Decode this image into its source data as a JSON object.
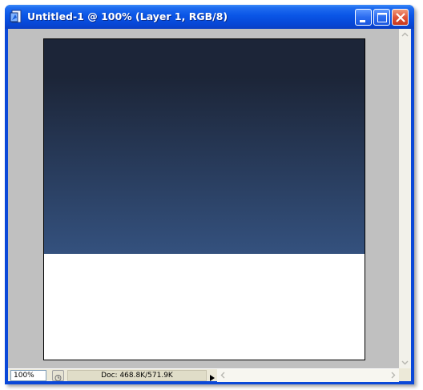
{
  "window": {
    "title": "Untitled-1 @ 100% (Layer 1, RGB/8)",
    "buttons": [
      "minimize",
      "maximize",
      "close"
    ]
  },
  "canvas": {
    "gradient_colors": [
      "#1c2538",
      "#34517e"
    ],
    "background_color": "#ffffff",
    "gradient_fill_fraction": 0.67
  },
  "status": {
    "zoom": "100%",
    "doc_info": "Doc: 468.8K/571.9K"
  },
  "icons": {
    "app": "photoshop-document-icon",
    "navigator": "navigator-icon",
    "status_menu": "triangle-right-icon"
  }
}
